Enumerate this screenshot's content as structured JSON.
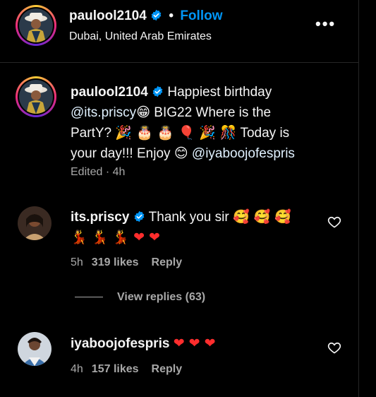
{
  "header": {
    "username": "paulool2104",
    "separator": "•",
    "follow_label": "Follow",
    "location": "Dubai, United Arab Emirates",
    "more_label": "•••"
  },
  "caption": {
    "username": "paulool2104",
    "text_1": "Happiest birthday",
    "mention_1": "@its.priscy",
    "emoji_1": "😁",
    "text_2": "BIG22 Where is the PartY?",
    "emojis_2": "🎉 🎂 🎂 🎈 🎉 🎊",
    "text_3": "Today is your day!!! Enjoy",
    "emoji_3": "😊",
    "mention_2": "@iyaboojofespris",
    "meta": "Edited · 4h"
  },
  "comments": [
    {
      "username": "its.priscy",
      "text": "Thank you sir",
      "emojis_1": "🥰 🥰 🥰",
      "emojis_2": "💃 💃 💃 ❤ ❤",
      "time": "5h",
      "likes": "319 likes",
      "reply_label": "Reply"
    },
    {
      "username": "iyaboojofespris",
      "text": "",
      "emojis_1": "❤ ❤ ❤",
      "time": "4h",
      "likes": "157 likes",
      "reply_label": "Reply"
    }
  ],
  "view_replies_label": "View replies (63)",
  "colors": {
    "background": "#000000",
    "text": "#f5f5f5",
    "muted": "#a8a8a8",
    "link": "#0095f6",
    "verified": "#0095f6",
    "heart": "#ff2d2d"
  }
}
